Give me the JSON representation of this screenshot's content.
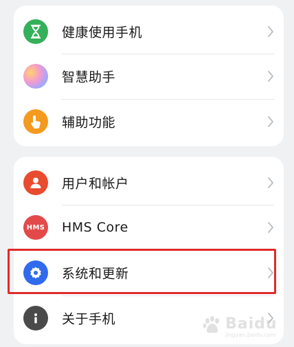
{
  "card1": {
    "items": [
      {
        "label": "健康使用手机",
        "icon": "hourglass-icon",
        "color": "#35b05a"
      },
      {
        "label": "智慧助手",
        "icon": "assistant-orb-icon",
        "color": "#d88bd0"
      },
      {
        "label": "辅助功能",
        "icon": "hand-pointer-icon",
        "color": "#f39a1f"
      }
    ]
  },
  "card2": {
    "items": [
      {
        "label": "用户和帐户",
        "icon": "user-icon",
        "color": "#e84b2e"
      },
      {
        "label": "HMS Core",
        "icon": "hms-logo-icon",
        "color": "#e24a4a",
        "icon_text": "HMS"
      },
      {
        "label": "系统和更新",
        "icon": "gear-icon",
        "color": "#2f6bec"
      },
      {
        "label": "关于手机",
        "icon": "info-icon",
        "color": "#4a4a4a"
      }
    ]
  },
  "highlight_color": "#e02a2a",
  "watermark": {
    "text": "Baidu",
    "sub": "jingyan.baidu.com"
  }
}
